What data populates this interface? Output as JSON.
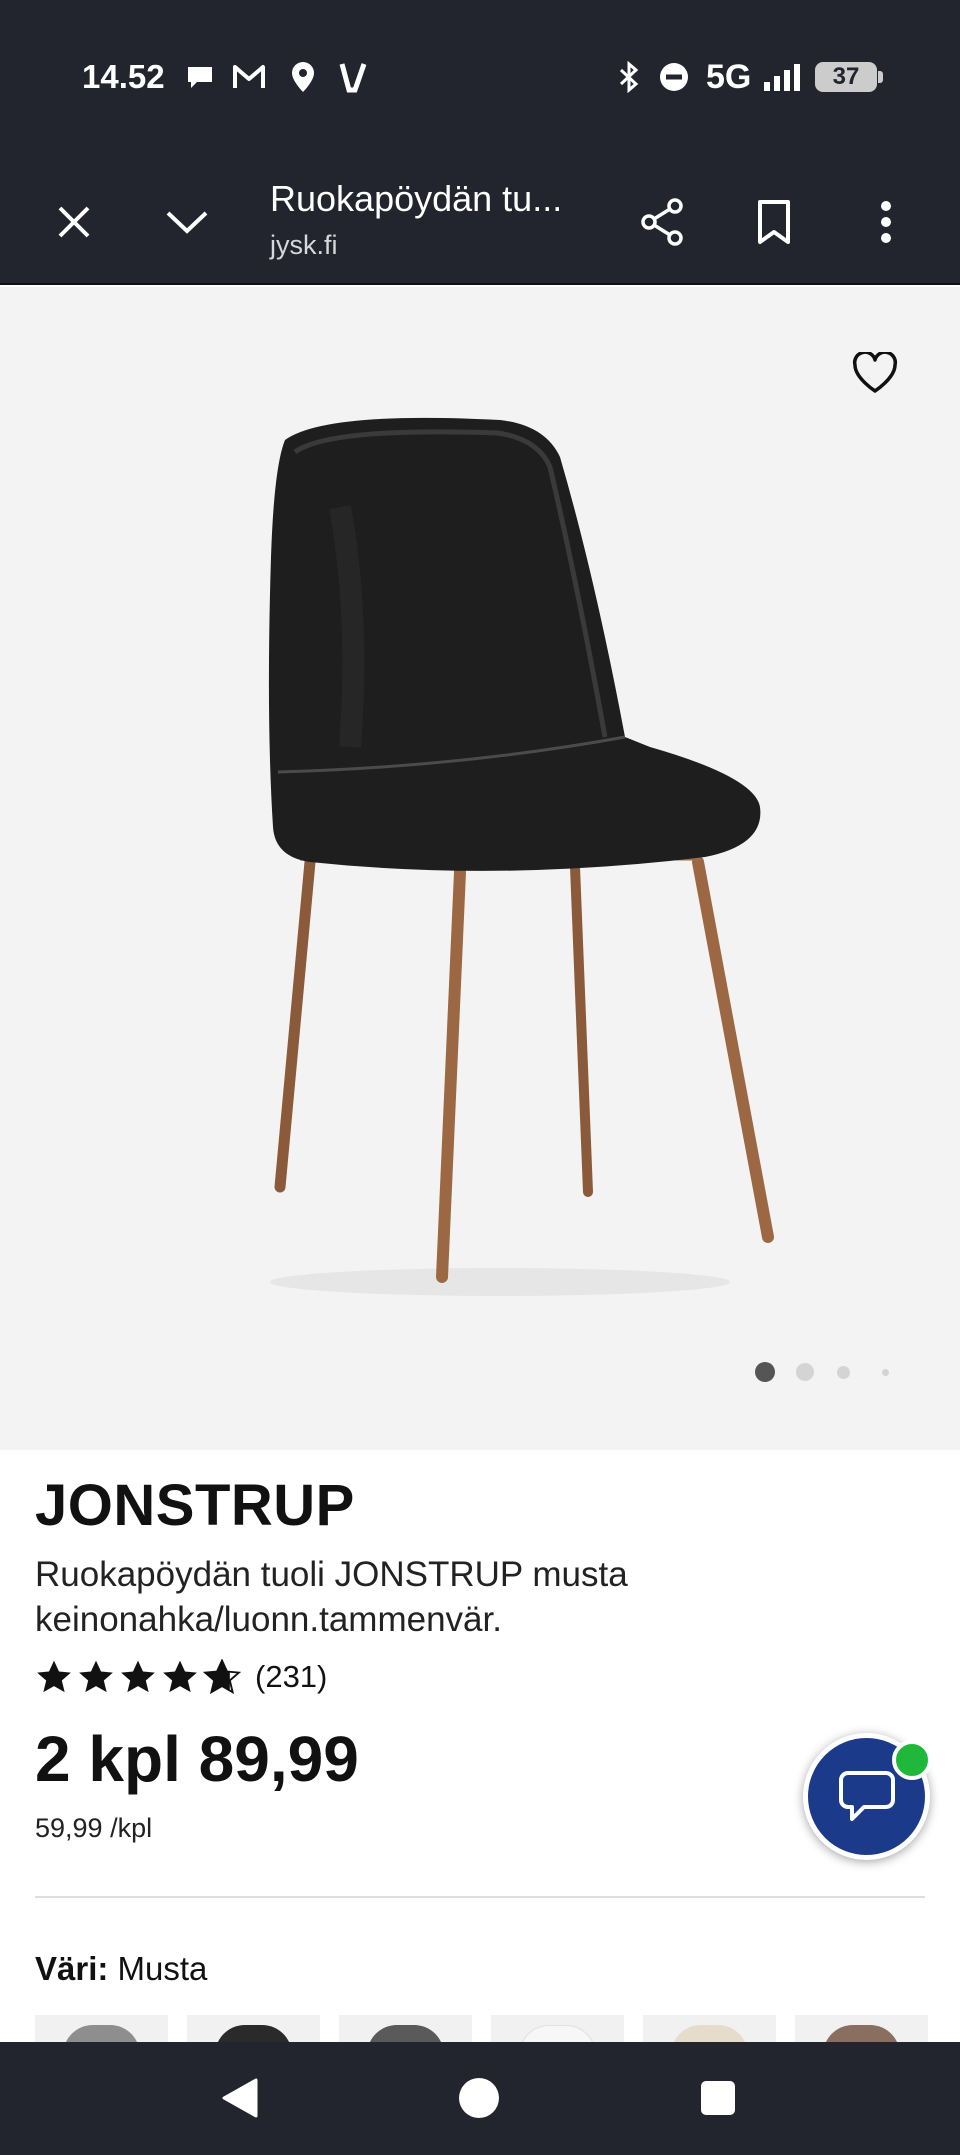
{
  "status_bar": {
    "time": "14.52",
    "network": "5G",
    "battery": "37",
    "icons": [
      "chat-bubble-icon",
      "gmail-icon",
      "location-icon",
      "v-app-icon",
      "bluetooth-icon",
      "do-not-disturb-icon",
      "signal-icon",
      "battery-icon"
    ]
  },
  "browser": {
    "page_title": "Ruokapöydän tu...",
    "url": "jysk.fi",
    "icons": [
      "close-icon",
      "chevron-down-icon",
      "share-icon",
      "bookmark-icon",
      "more-vert-icon"
    ]
  },
  "product": {
    "name": "JONSTRUP",
    "description": "Ruokapöydän tuoli JONSTRUP musta keinonahka/luonn.tammenvär.",
    "rating": 4.7,
    "rating_count": "(231)",
    "price": "2 kpl 89,99",
    "unit_price": "59,99 /kpl",
    "color_label": "Väri:",
    "color_value": "Musta",
    "image_count": 4,
    "active_image": 0
  },
  "swatches": [
    {
      "name": "grey",
      "color": "#8e8e8e"
    },
    {
      "name": "black",
      "color": "#2a2a2a"
    },
    {
      "name": "dark-grey",
      "color": "#5a5a5a"
    },
    {
      "name": "white",
      "color": "#f7f7f7"
    },
    {
      "name": "beige",
      "color": "#e6dccb"
    },
    {
      "name": "brown",
      "color": "#8a6e60"
    }
  ],
  "colors": {
    "system_bar": "#22252d",
    "chat_button": "#1b3a8a",
    "online_badge": "#1fb83a",
    "hero_background": "#f3f3f3"
  }
}
